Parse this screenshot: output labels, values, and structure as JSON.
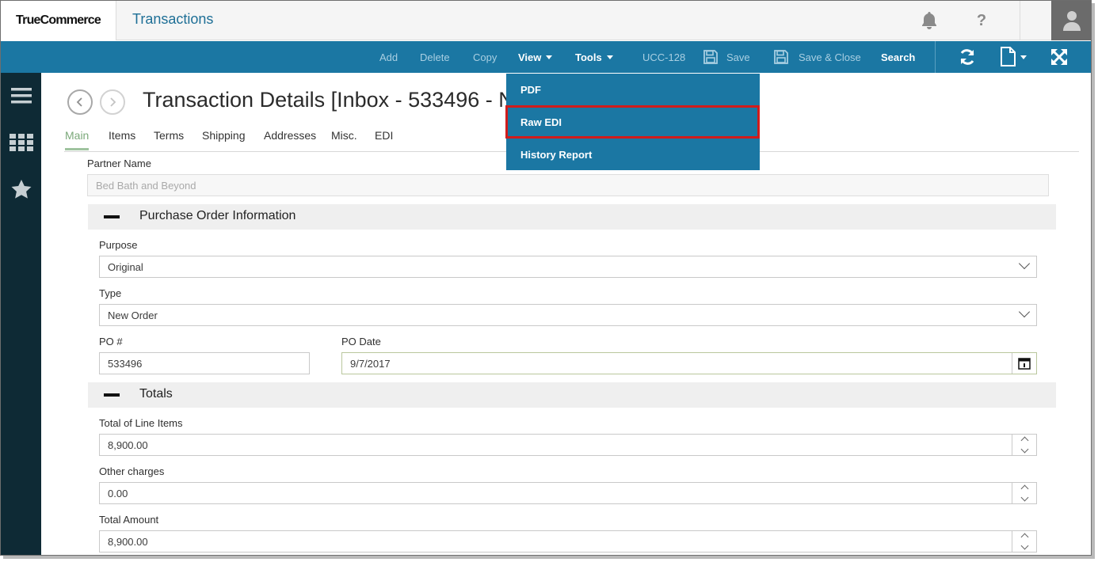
{
  "app": {
    "logo": "TrueCommerce",
    "title": "Transactions"
  },
  "toolbar": {
    "add": "Add",
    "delete": "Delete",
    "copy": "Copy",
    "view": "View",
    "tools": "Tools",
    "ucc": "UCC-128",
    "save": "Save",
    "save_close": "Save & Close",
    "search": "Search"
  },
  "view_menu": {
    "items": [
      "PDF",
      "Raw EDI",
      "History Report"
    ],
    "highlighted": "Raw EDI"
  },
  "page": {
    "title": "Transaction Details [Inbox - 533496 - N"
  },
  "tabs": [
    "Main",
    "Items",
    "Terms",
    "Shipping",
    "Addresses",
    "Misc.",
    "EDI"
  ],
  "active_tab": "Main",
  "form": {
    "partner_label": "Partner Name",
    "partner_value": "Bed Bath and Beyond",
    "po_section": "Purchase Order Information",
    "purpose_label": "Purpose",
    "purpose_value": "Original",
    "type_label": "Type",
    "type_value": "New Order",
    "po_num_label": "PO #",
    "po_num_value": "533496",
    "po_date_label": "PO Date",
    "po_date_value": "9/7/2017",
    "totals_section": "Totals",
    "total_line_label": "Total of Line Items",
    "total_line_value": "8,900.00",
    "other_charges_label": "Other charges",
    "other_charges_value": "0.00",
    "total_amount_label": "Total Amount",
    "total_amount_value": "8,900.00"
  },
  "icons": [
    "bell-icon",
    "help-icon",
    "user-avatar-icon",
    "refresh-icon",
    "new-document-icon",
    "expand-icon",
    "menu-icon",
    "apps-grid-icon",
    "star-icon",
    "back-icon",
    "forward-icon",
    "save-icon",
    "calendar-icon"
  ],
  "colors": {
    "toolbar": "#1b77a3",
    "rail": "#0e2a35",
    "accent_tab": "#7ba97a",
    "highlight": "#d11b1b"
  }
}
